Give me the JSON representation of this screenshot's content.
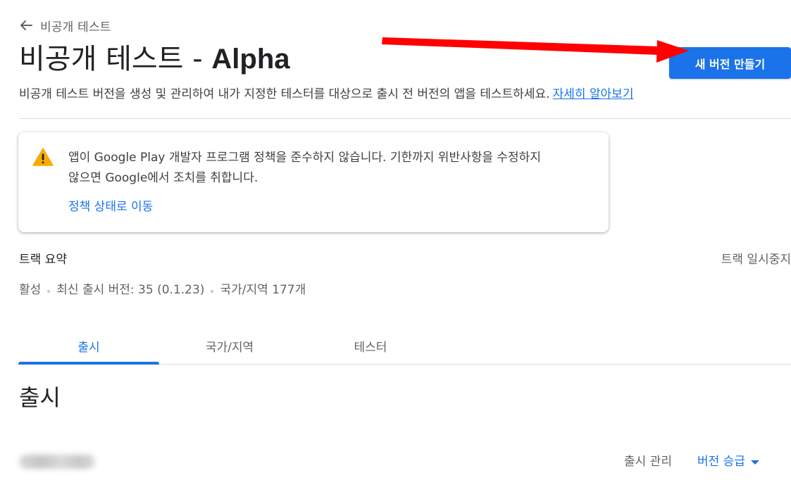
{
  "back": {
    "label": "비공개 테스트",
    "icon": "arrow-back-icon"
  },
  "header": {
    "title_ko": "비공개 테스트 - ",
    "title_en": "Alpha",
    "create_button_label": "새 버전 만들기"
  },
  "description": {
    "text": "비공개 테스트 버전을 생성 및 관리하여 내가 지정한 테스터를 대상으로 출시 전 버전의 앱을 테스트하세요.",
    "learn_more_label": "자세히 알아보기"
  },
  "warning": {
    "icon": "warning-icon",
    "message_line1": "앱이 Google Play 개발자 프로그램 정책을 준수하지 않습니다. 기한까지 위반사항을 수정하지",
    "message_line2": "않으면 Google에서 조치를 취합니다.",
    "link_label": "정책 상태로 이동",
    "color": "#f9ab00"
  },
  "track": {
    "summary_label": "트랙 요약",
    "pause_label": "트랙 일시중지",
    "status": "활성",
    "latest_release": "최신 출시 버전: 35 (0.1.23)",
    "countries": "국가/지역 177개"
  },
  "tabs": [
    {
      "label": "출시",
      "active": true
    },
    {
      "label": "국가/지역",
      "active": false
    },
    {
      "label": "테스터",
      "active": false
    }
  ],
  "releases": {
    "title": "출시",
    "manage_label": "출시 관리",
    "promote_label": "버전 승급",
    "promote_icon": "caret-down-icon"
  },
  "colors": {
    "accent": "#1a73e8",
    "annotation_arrow": "#ff0000"
  }
}
